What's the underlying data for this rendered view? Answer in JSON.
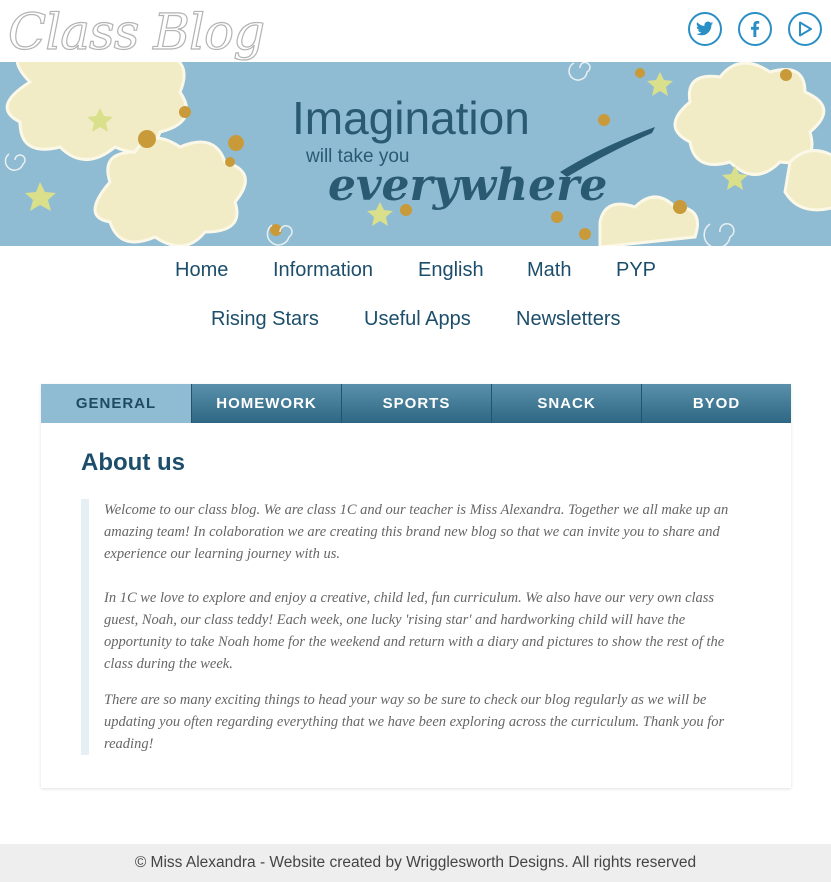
{
  "header": {
    "logo": "Class Blog",
    "social": [
      {
        "name": "twitter-icon"
      },
      {
        "name": "facebook-icon"
      },
      {
        "name": "youtube-icon"
      }
    ],
    "accent_color": "#2a8fc4"
  },
  "banner": {
    "line1": "Imagination",
    "line2": "will take you",
    "line3": "everywhere",
    "bg_color": "#8fbcd3"
  },
  "nav": {
    "items": [
      "Home",
      "Information",
      "English",
      "Math",
      "PYP",
      "Rising Stars",
      "Useful Apps",
      "Newsletters"
    ]
  },
  "tabs": {
    "items": [
      "GENERAL",
      "HOMEWORK",
      "SPORTS",
      "SNACK",
      "BYOD"
    ],
    "active": "GENERAL"
  },
  "about": {
    "heading": "About us",
    "p1": "Welcome to our class blog. We are class 1C and our teacher is Miss Alexandra. Together we all make up an amazing team! In colaboration we are creating this brand new blog so that we can invite you to share and experience our learning journey with us.",
    "p2": "In 1C we love to explore and enjoy a creative, child led, fun curriculum. We also have our very own class guest, Noah, our class teddy! Each week, one lucky 'rising star' and hardworking child will have the opportunity to take Noah home for the weekend and return with a diary and pictures to show the rest of the class during the week.",
    "p3": "There are so many exciting things to head your way so be sure to check our blog regularly as we will be updating you often regarding everything that we have been exploring across the curriculum. Thank you for reading!"
  },
  "footer": {
    "text": "© Miss Alexandra - Website created by Wrigglesworth Designs. All rights reserved"
  }
}
